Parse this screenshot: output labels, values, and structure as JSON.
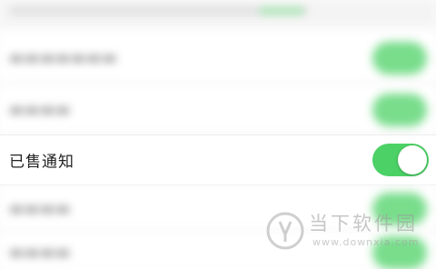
{
  "settings": {
    "active_item": {
      "label": "已售通知",
      "enabled": true
    }
  },
  "watermark": {
    "title": "当下软件园",
    "url": "www.downxia.com"
  },
  "colors": {
    "toggle_on": "#4cd166",
    "background": "#fbfbfb",
    "text": "#222222"
  }
}
